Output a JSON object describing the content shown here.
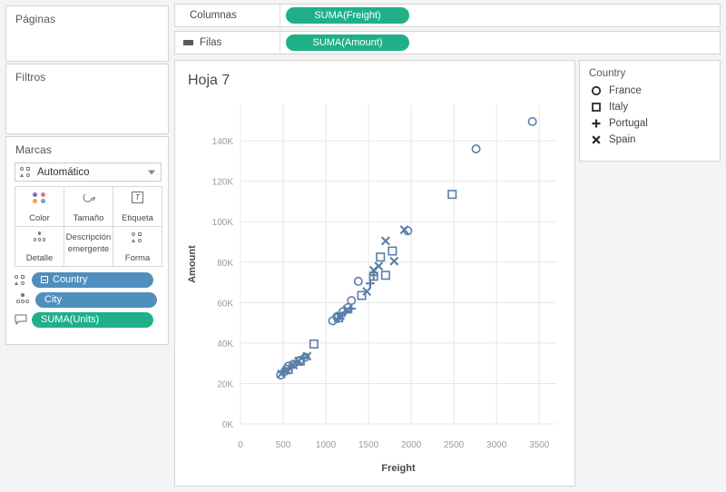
{
  "left_panel": {
    "pages": {
      "title": "Páginas"
    },
    "filters": {
      "title": "Filtros"
    },
    "marks": {
      "title": "Marcas",
      "type_selector": {
        "value": "Automático",
        "icon": "shape-icon",
        "caret": "chevron-down-icon"
      },
      "buttons": [
        {
          "label": "Color",
          "icon": "color-dots-icon"
        },
        {
          "label": "Tamaño",
          "icon": "size-icon"
        },
        {
          "label": "Etiqueta",
          "icon": "label-icon"
        },
        {
          "label": "Detalle",
          "icon": "detail-icon"
        },
        {
          "label_line1": "Descripción",
          "label_line2": "emergente",
          "icon": "tooltip-icon"
        },
        {
          "label": "Forma",
          "icon": "shape-icon"
        }
      ],
      "pills": [
        {
          "label": "Country",
          "color": "blue",
          "icon": "shape-icon",
          "has_group_square": true
        },
        {
          "label": "City",
          "color": "blue",
          "icon": "detail-icon",
          "has_group_square": false
        },
        {
          "label": "SUMA(Units)",
          "color": "green",
          "icon": "tooltip-icon",
          "has_group_square": false
        }
      ]
    }
  },
  "shelves": {
    "columns": {
      "label": "Columnas",
      "icon": "columns-icon",
      "pill": "SUMA(Freight)"
    },
    "rows": {
      "label": "Filas",
      "icon": "rows-icon",
      "pill": "SUMA(Amount)"
    }
  },
  "view": {
    "sheet_title": "Hoja 7"
  },
  "legend": {
    "title": "Country",
    "items": [
      {
        "label": "France",
        "shape": "circle-icon"
      },
      {
        "label": "Italy",
        "shape": "square-icon"
      },
      {
        "label": "Portugal",
        "shape": "plus-icon"
      },
      {
        "label": "Spain",
        "shape": "cross-icon"
      }
    ]
  },
  "colors": {
    "mark": "#5a7fa8",
    "pill_blue": "#4f8fbd",
    "pill_green": "#1fb089",
    "grid": "#e8e8e8",
    "axis_text": "#9a9a9a",
    "panel_bg": "#ffffff",
    "app_bg": "#f4f4f4"
  },
  "chart_data": {
    "type": "scatter",
    "title": "Hoja 7",
    "xlabel": "Freight",
    "ylabel": "Amount",
    "xlim": [
      0,
      3700
    ],
    "ylim": [
      0,
      158000
    ],
    "xticks": [
      0,
      500,
      1000,
      1500,
      2000,
      2500,
      3000,
      3500
    ],
    "xticklabels": [
      "0",
      "500",
      "1000",
      "1500",
      "2000",
      "2500",
      "3000",
      "3500"
    ],
    "yticks": [
      0,
      20000,
      40000,
      60000,
      80000,
      100000,
      120000,
      140000
    ],
    "yticklabels": [
      "0K",
      "20K",
      "40K",
      "60K",
      "80K",
      "100K",
      "120K",
      "140K"
    ],
    "grid": true,
    "legend_position": "right",
    "legend_title": "Country",
    "series": [
      {
        "name": "France",
        "shape": "circle",
        "points": [
          [
            470,
            24200
          ],
          [
            520,
            26000
          ],
          [
            560,
            28500
          ],
          [
            620,
            29500
          ],
          [
            700,
            31500
          ],
          [
            760,
            33000
          ],
          [
            1080,
            51000
          ],
          [
            1130,
            53000
          ],
          [
            1200,
            55500
          ],
          [
            1260,
            57500
          ],
          [
            1300,
            61000
          ],
          [
            1380,
            70500
          ],
          [
            1960,
            95500
          ],
          [
            2760,
            136000
          ],
          [
            3420,
            149500
          ]
        ]
      },
      {
        "name": "Italy",
        "shape": "square",
        "points": [
          [
            560,
            27000
          ],
          [
            700,
            31000
          ],
          [
            860,
            39500
          ],
          [
            1150,
            52500
          ],
          [
            1420,
            63500
          ],
          [
            1560,
            73000
          ],
          [
            1640,
            82500
          ],
          [
            1700,
            73500
          ],
          [
            1780,
            85500
          ],
          [
            2480,
            113500
          ]
        ]
      },
      {
        "name": "Portugal",
        "shape": "plus",
        "points": [
          [
            500,
            25500
          ],
          [
            600,
            28000
          ],
          [
            660,
            30500
          ],
          [
            740,
            32500
          ],
          [
            1140,
            52000
          ],
          [
            1220,
            55000
          ],
          [
            1300,
            57000
          ],
          [
            1520,
            69500
          ],
          [
            1560,
            73500
          ]
        ]
      },
      {
        "name": "Spain",
        "shape": "cross",
        "points": [
          [
            480,
            24800
          ],
          [
            540,
            26500
          ],
          [
            620,
            29000
          ],
          [
            680,
            31000
          ],
          [
            780,
            33500
          ],
          [
            1170,
            53500
          ],
          [
            1250,
            56500
          ],
          [
            1480,
            65500
          ],
          [
            1560,
            76000
          ],
          [
            1620,
            78000
          ],
          [
            1700,
            90500
          ],
          [
            1800,
            80500
          ],
          [
            1920,
            96000
          ]
        ]
      }
    ]
  }
}
